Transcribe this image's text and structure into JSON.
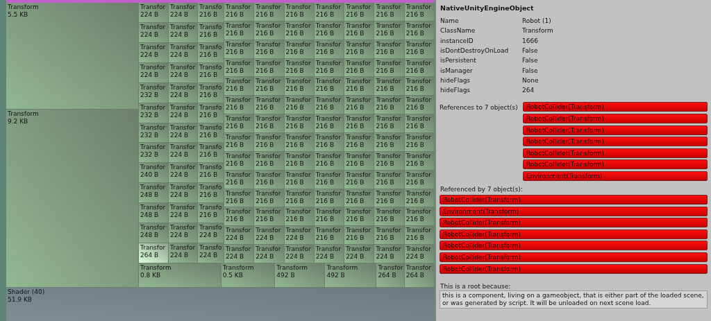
{
  "treemap": {
    "large": [
      {
        "label": "Transform",
        "size": "5.5 KB",
        "selected": false
      },
      {
        "label": "Transform",
        "size": "9.2 KB",
        "selected": false
      }
    ],
    "columns": [
      {
        "tiles": [
          {
            "label": "Transfor",
            "size": "224 B",
            "selected": false
          },
          {
            "label": "Transfor",
            "size": "224 B",
            "selected": false
          },
          {
            "label": "Transfor",
            "size": "224 B",
            "selected": false
          },
          {
            "label": "Transfor",
            "size": "224 B",
            "selected": false
          },
          {
            "label": "Transfor",
            "size": "232 B",
            "selected": false
          },
          {
            "label": "Transfor",
            "size": "232 B",
            "selected": false
          },
          {
            "label": "Transfor",
            "size": "232 B",
            "selected": false
          },
          {
            "label": "Transfor",
            "size": "232 B",
            "selected": false
          },
          {
            "label": "Transfor",
            "size": "240 B",
            "selected": false
          },
          {
            "label": "Transfor",
            "size": "248 B",
            "selected": false
          },
          {
            "label": "Transfor",
            "size": "248 B",
            "selected": false
          },
          {
            "label": "Transfor",
            "size": "248 B",
            "selected": false
          },
          {
            "label": "Transfor",
            "size": "264 B",
            "selected": true
          }
        ]
      },
      {
        "tiles": [
          {
            "label": "Transfor",
            "size": "224 B",
            "selected": false
          },
          {
            "label": "Transfor",
            "size": "224 B",
            "selected": false
          },
          {
            "label": "Transfor",
            "size": "224 B",
            "selected": false
          },
          {
            "label": "Transfor",
            "size": "224 B",
            "selected": false
          },
          {
            "label": "Transfor",
            "size": "224 B",
            "selected": false
          },
          {
            "label": "Transfor",
            "size": "224 B",
            "selected": false
          },
          {
            "label": "Transfor",
            "size": "224 B",
            "selected": false
          },
          {
            "label": "Transfor",
            "size": "224 B",
            "selected": false
          },
          {
            "label": "Transfor",
            "size": "224 B",
            "selected": false
          },
          {
            "label": "Transfor",
            "size": "224 B",
            "selected": false
          },
          {
            "label": "Transfor",
            "size": "224 B",
            "selected": false
          },
          {
            "label": "Transfor",
            "size": "224 B",
            "selected": false
          },
          {
            "label": "Transfor",
            "size": "224 B",
            "selected": false
          }
        ]
      },
      {
        "tiles": [
          {
            "label": "Transfo",
            "size": "216 B",
            "selected": false
          },
          {
            "label": "Transfo",
            "size": "216 B",
            "selected": false
          },
          {
            "label": "Transfo",
            "size": "216 B",
            "selected": false
          },
          {
            "label": "Transfo",
            "size": "216 B",
            "selected": false
          },
          {
            "label": "Transfo",
            "size": "216 B",
            "selected": false
          },
          {
            "label": "Transfo",
            "size": "216 B",
            "selected": false
          },
          {
            "label": "Transfo",
            "size": "216 B",
            "selected": false
          },
          {
            "label": "Transfo",
            "size": "216 B",
            "selected": false
          },
          {
            "label": "Transfo",
            "size": "216 B",
            "selected": false
          },
          {
            "label": "Transfo",
            "size": "216 B",
            "selected": false
          },
          {
            "label": "Transfo",
            "size": "216 B",
            "selected": false
          },
          {
            "label": "Transfo",
            "size": "224 B",
            "selected": false
          },
          {
            "label": "Transfo",
            "size": "224 B",
            "selected": false
          }
        ]
      }
    ],
    "rows": [
      {
        "tiles": [
          {
            "label": "Transfor",
            "size": "216 B",
            "selected": false
          },
          {
            "label": "Transfor",
            "size": "216 B",
            "selected": false
          },
          {
            "label": "Transfor",
            "size": "216 B",
            "selected": false
          },
          {
            "label": "Transfor",
            "size": "216 B",
            "selected": false
          },
          {
            "label": "Transfor",
            "size": "216 B",
            "selected": false
          },
          {
            "label": "Transfor",
            "size": "216 B",
            "selected": false
          },
          {
            "label": "Transfor",
            "size": "216 B",
            "selected": false
          }
        ]
      },
      {
        "tiles": [
          {
            "label": "Transfor",
            "size": "216 B",
            "selected": false
          },
          {
            "label": "Transfor",
            "size": "216 B",
            "selected": false
          },
          {
            "label": "Transfor",
            "size": "216 B",
            "selected": false
          },
          {
            "label": "Transfor",
            "size": "216 B",
            "selected": false
          },
          {
            "label": "Transfor",
            "size": "216 B",
            "selected": false
          },
          {
            "label": "Transfor",
            "size": "216 B",
            "selected": false
          },
          {
            "label": "Transfor",
            "size": "216 B",
            "selected": false
          }
        ]
      },
      {
        "tiles": [
          {
            "label": "Transfor",
            "size": "216 B",
            "selected": false
          },
          {
            "label": "Transfor",
            "size": "216 B",
            "selected": false
          },
          {
            "label": "Transfor",
            "size": "216 B",
            "selected": false
          },
          {
            "label": "Transfor",
            "size": "216 B",
            "selected": false
          },
          {
            "label": "Transfor",
            "size": "216 B",
            "selected": false
          },
          {
            "label": "Transfor",
            "size": "216 B",
            "selected": false
          },
          {
            "label": "Transfor",
            "size": "216 B",
            "selected": false
          }
        ]
      },
      {
        "tiles": [
          {
            "label": "Transfor",
            "size": "216 B",
            "selected": false
          },
          {
            "label": "Transfor",
            "size": "216 B",
            "selected": false
          },
          {
            "label": "Transfor",
            "size": "216 B",
            "selected": false
          },
          {
            "label": "Transfor",
            "size": "216 B",
            "selected": false
          },
          {
            "label": "Transfor",
            "size": "216 B",
            "selected": false
          },
          {
            "label": "Transfor",
            "size": "216 B",
            "selected": false
          },
          {
            "label": "Transfor",
            "size": "216 B",
            "selected": false
          }
        ]
      },
      {
        "tiles": [
          {
            "label": "Transfor",
            "size": "216 B",
            "selected": false
          },
          {
            "label": "Transfor",
            "size": "216 B",
            "selected": false
          },
          {
            "label": "Transfor",
            "size": "216 B",
            "selected": false
          },
          {
            "label": "Transfor",
            "size": "216 B",
            "selected": false
          },
          {
            "label": "Transfor",
            "size": "216 B",
            "selected": false
          },
          {
            "label": "Transfor",
            "size": "216 B",
            "selected": false
          },
          {
            "label": "Transfor",
            "size": "216 B",
            "selected": false
          }
        ]
      },
      {
        "tiles": [
          {
            "label": "Transfor",
            "size": "216 B",
            "selected": false
          },
          {
            "label": "Transfor",
            "size": "216 B",
            "selected": false
          },
          {
            "label": "Transfor",
            "size": "216 B",
            "selected": false
          },
          {
            "label": "Transfor",
            "size": "216 B",
            "selected": false
          },
          {
            "label": "Transfor",
            "size": "216 B",
            "selected": false
          },
          {
            "label": "Transfor",
            "size": "216 B",
            "selected": false
          },
          {
            "label": "Transfor",
            "size": "216 B",
            "selected": false
          }
        ]
      },
      {
        "tiles": [
          {
            "label": "Transfor",
            "size": "216 B",
            "selected": false
          },
          {
            "label": "Transfor",
            "size": "216 B",
            "selected": false
          },
          {
            "label": "Transfor",
            "size": "216 B",
            "selected": false
          },
          {
            "label": "Transfor",
            "size": "216 B",
            "selected": false
          },
          {
            "label": "Transfor",
            "size": "216 B",
            "selected": false
          },
          {
            "label": "Transfor",
            "size": "216 B",
            "selected": false
          },
          {
            "label": "Transfor",
            "size": "216 B",
            "selected": false
          }
        ]
      },
      {
        "tiles": [
          {
            "label": "Transfor",
            "size": "216 B",
            "selected": false
          },
          {
            "label": "Transfor",
            "size": "216 B",
            "selected": false
          },
          {
            "label": "Transfor",
            "size": "216 B",
            "selected": false
          },
          {
            "label": "Transfor",
            "size": "216 B",
            "selected": false
          },
          {
            "label": "Transfor",
            "size": "216 B",
            "selected": false
          },
          {
            "label": "Transfor",
            "size": "216 B",
            "selected": false
          },
          {
            "label": "Transfor",
            "size": "216 B",
            "selected": false
          }
        ]
      },
      {
        "tiles": [
          {
            "label": "Transfor",
            "size": "216 B",
            "selected": false
          },
          {
            "label": "Transfor",
            "size": "216 B",
            "selected": false
          },
          {
            "label": "Transfor",
            "size": "216 B",
            "selected": false
          },
          {
            "label": "Transfor",
            "size": "216 B",
            "selected": false
          },
          {
            "label": "Transfor",
            "size": "216 B",
            "selected": false
          },
          {
            "label": "Transfor",
            "size": "216 B",
            "selected": false
          },
          {
            "label": "Transfor",
            "size": "216 B",
            "selected": false
          }
        ]
      },
      {
        "tiles": [
          {
            "label": "Transfor",
            "size": "216 B",
            "selected": false
          },
          {
            "label": "Transfor",
            "size": "216 B",
            "selected": false
          },
          {
            "label": "Transfor",
            "size": "216 B",
            "selected": false
          },
          {
            "label": "Transfor",
            "size": "216 B",
            "selected": false
          },
          {
            "label": "Transfor",
            "size": "216 B",
            "selected": false
          },
          {
            "label": "Transfor",
            "size": "216 B",
            "selected": false
          },
          {
            "label": "Transfor",
            "size": "216 B",
            "selected": false
          }
        ]
      },
      {
        "tiles": [
          {
            "label": "Transfor",
            "size": "216 B",
            "selected": false
          },
          {
            "label": "Transfor",
            "size": "216 B",
            "selected": false
          },
          {
            "label": "Transfor",
            "size": "216 B",
            "selected": false
          },
          {
            "label": "Transfor",
            "size": "216 B",
            "selected": false
          },
          {
            "label": "Transfor",
            "size": "216 B",
            "selected": false
          },
          {
            "label": "Transfor",
            "size": "216 B",
            "selected": false
          },
          {
            "label": "Transfor",
            "size": "216 B",
            "selected": false
          }
        ]
      },
      {
        "tiles": [
          {
            "label": "Transfor",
            "size": "216 B",
            "selected": false
          },
          {
            "label": "Transfor",
            "size": "216 B",
            "selected": false
          },
          {
            "label": "Transfor",
            "size": "216 B",
            "selected": false
          },
          {
            "label": "Transfor",
            "size": "216 B",
            "selected": false
          },
          {
            "label": "Transfor",
            "size": "216 B",
            "selected": false
          },
          {
            "label": "Transfor",
            "size": "216 B",
            "selected": false
          },
          {
            "label": "Transfor",
            "size": "216 B",
            "selected": false
          }
        ]
      },
      {
        "tiles": [
          {
            "label": "Transfor",
            "size": "224 B",
            "selected": false
          },
          {
            "label": "Transfor",
            "size": "224 B",
            "selected": false
          },
          {
            "label": "Transfor",
            "size": "224 B",
            "selected": false
          },
          {
            "label": "Transfor",
            "size": "216 B",
            "selected": false
          },
          {
            "label": "Transfor",
            "size": "216 B",
            "selected": false
          },
          {
            "label": "Transfor",
            "size": "216 B",
            "selected": false
          },
          {
            "label": "Transfor",
            "size": "216 B",
            "selected": false
          }
        ]
      },
      {
        "tiles": [
          {
            "label": "Transfor",
            "size": "224 B",
            "selected": false
          },
          {
            "label": "Transfor",
            "size": "224 B",
            "selected": false
          },
          {
            "label": "Transfor",
            "size": "224 B",
            "selected": false
          },
          {
            "label": "Transfor",
            "size": "224 B",
            "selected": false
          },
          {
            "label": "Transfor",
            "size": "224 B",
            "selected": false
          },
          {
            "label": "Transfor",
            "size": "224 B",
            "selected": false
          },
          {
            "label": "Transfor",
            "size": "224 B",
            "selected": false
          }
        ]
      }
    ],
    "bottom_row": [
      {
        "label": "Transform",
        "size": "0.8 KB",
        "selected": false
      },
      {
        "label": "Transform",
        "size": "0.5 KB",
        "selected": false
      },
      {
        "label": "Transform",
        "size": "492 B",
        "selected": false
      },
      {
        "label": "Transform",
        "size": "492 B",
        "selected": false
      },
      {
        "label": "Transfor",
        "size": "264 B",
        "selected": false
      },
      {
        "label": "Transfor",
        "size": "264 B",
        "selected": false
      }
    ],
    "shader": {
      "label": "Shader (40)",
      "size": "51.9 KB",
      "selected": false
    }
  },
  "inspector": {
    "title": "NativeUnityEngineObject",
    "properties": [
      {
        "name": "Name",
        "value": "Robot (1)"
      },
      {
        "name": "ClassName",
        "value": "Transform"
      },
      {
        "name": "instanceID",
        "value": "1666"
      },
      {
        "name": "isDontDestroyOnLoad",
        "value": "False"
      },
      {
        "name": "isPersistent",
        "value": "False"
      },
      {
        "name": "isManager",
        "value": "False"
      },
      {
        "name": "hideFlags",
        "value": "None"
      },
      {
        "name": "hideFlags",
        "value": "264"
      }
    ],
    "references_label": "References to 7 object(s)",
    "references": [
      "RobotCollider(Transform)",
      "RobotCollider(Transform)",
      "RobotCollider(Transform)",
      "RobotCollider(Transform)",
      "RobotCollider(Transform)",
      "RobotCollider(Transform)",
      "Environment(Transform)"
    ],
    "referenced_by_label": "Referenced by 7 object(s):",
    "referenced_by": [
      "RobotCollider(Transform)",
      "Environment(Transform)",
      "RobotCollider(Transform)",
      "RobotCollider(Transform)",
      "RobotCollider(Transform)",
      "RobotCollider(Transform)",
      "RobotCollider(Transform)"
    ],
    "root_label": "This is a root because:",
    "root_reason": "this is a component, living on a gameobject, that is either part of the loaded scene, or was generated by script. It will be unloaded on next scene load."
  }
}
